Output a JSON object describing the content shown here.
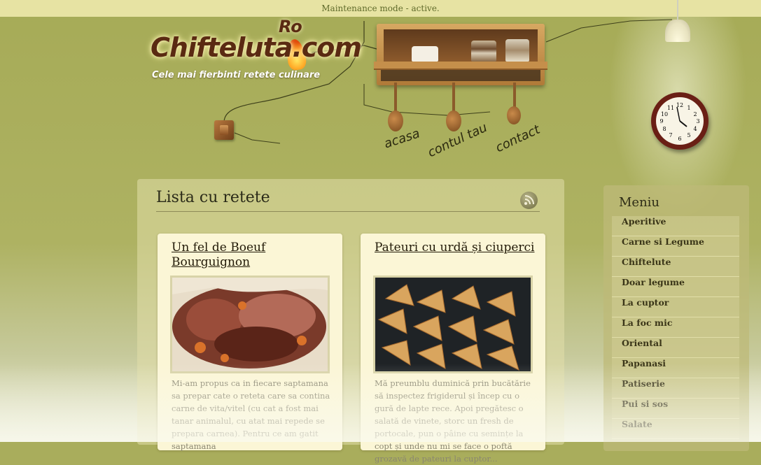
{
  "maintenance": "Maintenance mode - active.",
  "brand": {
    "logo": "Chifteluta.com",
    "logo_suffix": "Ro",
    "tagline": "Cele mai fierbinti retete culinare"
  },
  "nav": [
    {
      "label": "acasa"
    },
    {
      "label": "contul tau"
    },
    {
      "label": "contact"
    }
  ],
  "main": {
    "heading": "Lista cu retete",
    "recipes": [
      {
        "title": "Un fel de Boeuf Bourguignon",
        "excerpt": "Mi-am propus ca in fiecare saptamana sa prepar cate o reteta care sa contina carne de vita/vitel (cu cat a fost mai tanar animalul, cu atat mai repede se prepara carnea). Pentru ce am gatit saptamana"
      },
      {
        "title": "Pateuri cu urdă și ciuperci",
        "excerpt": "Mă preumblu duminică prin bucătărie să inspectez frigiderul și încep cu o gură de lapte rece. Apoi pregătesc o salată de vinete, storc un fresh de portocale, pun o pâine cu semințe la copt și unde nu mi se face o poftă grozavă de pateuri la cuptor..."
      }
    ]
  },
  "sidebar": {
    "title": "Meniu",
    "items": [
      {
        "label": "Aperitive"
      },
      {
        "label": "Carne si Legume"
      },
      {
        "label": "Chiftelute"
      },
      {
        "label": "Doar legume"
      },
      {
        "label": "La cuptor"
      },
      {
        "label": "La foc mic"
      },
      {
        "label": "Oriental"
      },
      {
        "label": "Papanasi"
      },
      {
        "label": "Patiserie"
      },
      {
        "label": "Pui si sos"
      },
      {
        "label": "Salate"
      }
    ]
  },
  "clock": {
    "numbers": [
      "12",
      "1",
      "2",
      "3",
      "4",
      "5",
      "6",
      "7",
      "8",
      "9",
      "10",
      "11"
    ]
  },
  "icons": {
    "rss": "rss-icon",
    "lamp": "lamp-icon",
    "clock": "clock-icon",
    "switch": "light-switch-icon"
  },
  "colors": {
    "background": "#a9ad5c",
    "maintenance_bar": "#e7e3a3",
    "card": "#fbf6d6",
    "logo": "#5a2a12"
  }
}
